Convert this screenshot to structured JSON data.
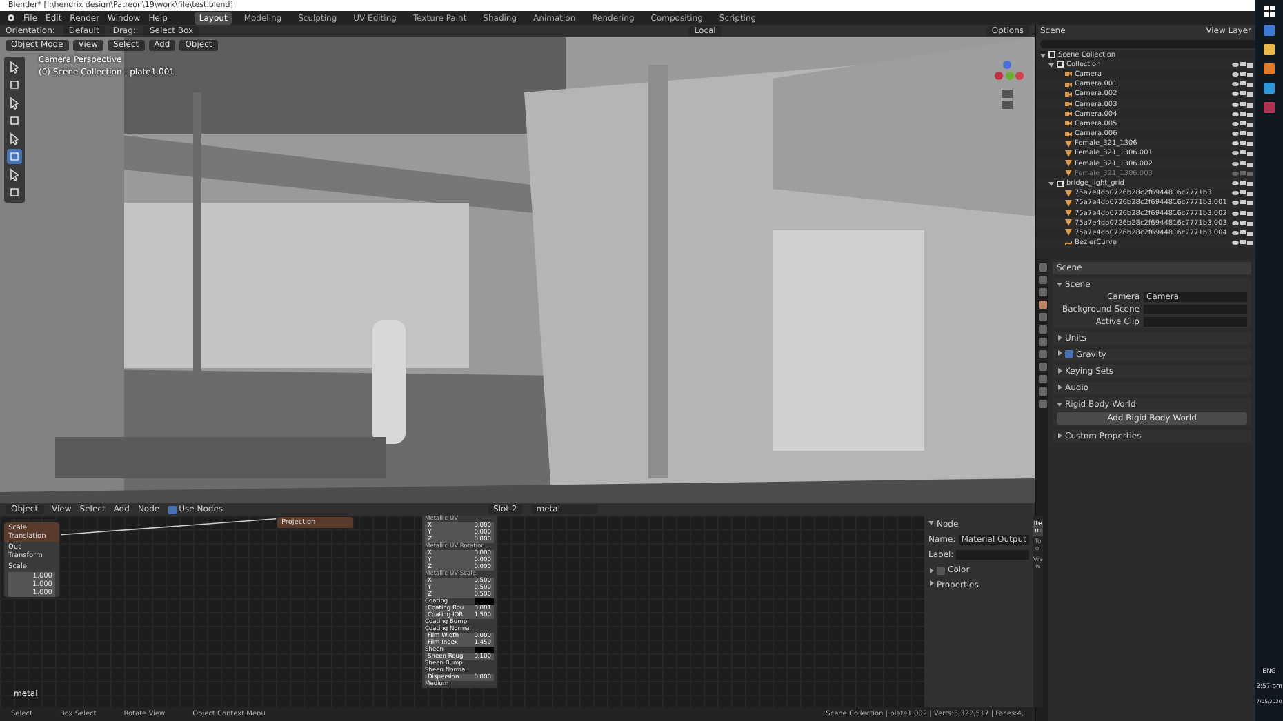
{
  "window": {
    "title": "Blender* [I:\\hendrix design\\Patreon\\19\\work\\file\\test.blend]"
  },
  "menu": [
    "File",
    "Edit",
    "Render",
    "Window",
    "Help"
  ],
  "workspaces": [
    {
      "label": "Layout",
      "selected": true
    },
    {
      "label": "Modeling",
      "selected": false
    },
    {
      "label": "Sculpting",
      "selected": false
    },
    {
      "label": "UV Editing",
      "selected": false
    },
    {
      "label": "Texture Paint",
      "selected": false
    },
    {
      "label": "Shading",
      "selected": false
    },
    {
      "label": "Animation",
      "selected": false
    },
    {
      "label": "Rendering",
      "selected": false
    },
    {
      "label": "Compositing",
      "selected": false
    },
    {
      "label": "Scripting",
      "selected": false
    }
  ],
  "tool_header": {
    "orientation_label": "Orientation:",
    "orientation": "Default",
    "drag_label": "Drag:",
    "drag": "Select Box",
    "transform": "Local",
    "options": "Options"
  },
  "viewport": {
    "mode": "Object Mode",
    "menus": [
      "View",
      "Select",
      "Add",
      "Object"
    ],
    "overlay_lines": [
      "Camera Perspective",
      "(0) Scene Collection | plate1.001"
    ]
  },
  "outliner": {
    "scene": "Scene",
    "view_layer": "View Layer",
    "tree": [
      {
        "name": "Scene Collection",
        "kind": "collection",
        "children": [
          {
            "name": "Collection",
            "kind": "collection",
            "children": [
              {
                "name": "Camera",
                "kind": "camera",
                "disabled": false
              },
              {
                "name": "Camera.001",
                "kind": "camera",
                "disabled": false
              },
              {
                "name": "Camera.002",
                "kind": "camera",
                "disabled": false
              },
              {
                "name": "Camera.003",
                "kind": "camera",
                "disabled": false
              },
              {
                "name": "Camera.004",
                "kind": "camera",
                "disabled": false
              },
              {
                "name": "Camera.005",
                "kind": "camera",
                "disabled": false
              },
              {
                "name": "Camera.006",
                "kind": "camera",
                "disabled": false
              },
              {
                "name": "Female_321_1306",
                "kind": "mesh",
                "disabled": false
              },
              {
                "name": "Female_321_1306.001",
                "kind": "mesh",
                "disabled": false
              },
              {
                "name": "Female_321_1306.002",
                "kind": "mesh",
                "disabled": false
              },
              {
                "name": "Female_321_1306.003",
                "kind": "mesh",
                "disabled": true
              }
            ]
          },
          {
            "name": "bridge_light_grid",
            "kind": "collection",
            "children": [
              {
                "name": "75a7e4db0726b28c2f6944816c7771b3",
                "kind": "mesh",
                "disabled": false
              },
              {
                "name": "75a7e4db0726b28c2f6944816c7771b3.001",
                "kind": "mesh",
                "disabled": false
              },
              {
                "name": "75a7e4db0726b28c2f6944816c7771b3.002",
                "kind": "mesh",
                "disabled": false
              },
              {
                "name": "75a7e4db0726b28c2f6944816c7771b3.003",
                "kind": "mesh",
                "disabled": false
              },
              {
                "name": "75a7e4db0726b28c2f6944816c7771b3.004",
                "kind": "mesh",
                "disabled": false
              },
              {
                "name": "BezierCurve",
                "kind": "curve",
                "disabled": false
              }
            ]
          }
        ]
      }
    ]
  },
  "properties": {
    "context": "Scene",
    "sections": [
      {
        "kind": "panel",
        "title": "Scene",
        "expanded": true,
        "fields": [
          {
            "label": "Camera",
            "value": "Camera"
          },
          {
            "label": "Background Scene"
          },
          {
            "label": "Active Clip"
          }
        ]
      },
      {
        "kind": "panel",
        "title": "Units",
        "expanded": false
      },
      {
        "kind": "check",
        "title": "Gravity",
        "checked": true
      },
      {
        "kind": "panel",
        "title": "Keying Sets",
        "expanded": false
      },
      {
        "kind": "panel",
        "title": "Audio",
        "expanded": false
      },
      {
        "kind": "panel",
        "title": "Rigid Body World",
        "expanded": true,
        "button": "Add Rigid Body World"
      },
      {
        "kind": "panel",
        "title": "Custom Properties",
        "expanded": false
      }
    ]
  },
  "node_editor": {
    "type": "Object",
    "menus": [
      "View",
      "Select",
      "Add",
      "Node"
    ],
    "use_nodes": {
      "label": "Use Nodes",
      "checked": true
    },
    "slot": "Slot 2",
    "material": "metal",
    "material_label": "metal",
    "nodes": [
      {
        "title": "Scale Translation",
        "rows": [
          "Out Transform",
          "Scale",
          "1.000",
          "1.000",
          "1.000"
        ]
      },
      {
        "title": "Projection"
      }
    ],
    "bsdf_rows": [
      {
        "kind": "header",
        "label": "Metallic UV"
      },
      {
        "kind": "value",
        "label": "X",
        "value": "0.000"
      },
      {
        "kind": "value",
        "label": "Y",
        "value": "0.000"
      },
      {
        "kind": "value",
        "label": "Z",
        "value": "0.000"
      },
      {
        "kind": "header",
        "label": "Metallic UV Rotation"
      },
      {
        "kind": "value",
        "label": "X",
        "value": "0.000"
      },
      {
        "kind": "value",
        "label": "Y",
        "value": "0.000"
      },
      {
        "kind": "value",
        "label": "Z",
        "value": "0.000"
      },
      {
        "kind": "header",
        "label": "Metallic UV Scale"
      },
      {
        "kind": "value",
        "label": "X",
        "value": "0.500"
      },
      {
        "kind": "value",
        "label": "Y",
        "value": "0.500"
      },
      {
        "kind": "value",
        "label": "Z",
        "value": "0.500"
      },
      {
        "kind": "color",
        "label": "Coating"
      },
      {
        "kind": "value",
        "label": "Coating Rou",
        "value": "0.001"
      },
      {
        "kind": "value",
        "label": "Coating IOR",
        "value": "1.500"
      },
      {
        "kind": "socket",
        "label": "Coating Bump"
      },
      {
        "kind": "socket",
        "label": "Coating Normal"
      },
      {
        "kind": "value",
        "label": "Film Width",
        "value": "0.000"
      },
      {
        "kind": "value",
        "label": "Film Index",
        "value": "1.450"
      },
      {
        "kind": "color",
        "label": "Sheen"
      },
      {
        "kind": "value",
        "label": "Sheen Roug",
        "value": "0.100"
      },
      {
        "kind": "socket",
        "label": "Sheen Bump"
      },
      {
        "kind": "socket",
        "label": "Sheen Normal"
      },
      {
        "kind": "value",
        "label": "Dispersion",
        "value": "0.000"
      },
      {
        "kind": "socket",
        "label": "Medium"
      }
    ],
    "sidebar": {
      "panel": "Node",
      "name_label": "Name:",
      "name": "Material Output",
      "label_label": "Label:",
      "color_label": "Color",
      "color_checked": false,
      "properties": "Properties",
      "tabs": [
        {
          "label": "Item",
          "selected": true
        },
        {
          "label": "Tool",
          "selected": false
        },
        {
          "label": "View",
          "selected": false
        }
      ]
    }
  },
  "status_bar": {
    "hints": [
      "Select",
      "Box Select",
      "Rotate View",
      "Object Context Menu"
    ],
    "stats": "Scene Collection | plate1.002 | Verts:3,322,517 | Faces:4,"
  },
  "taskbar": {
    "time": "2:57 pm",
    "date": "7/05/2020",
    "language": "ENG"
  }
}
